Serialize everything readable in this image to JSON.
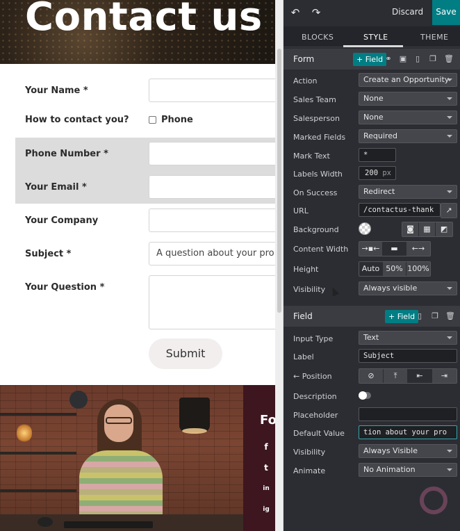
{
  "preview": {
    "hero_title": "Contact us",
    "form": {
      "fields": [
        {
          "label": "Your Name",
          "required": "*",
          "value": ""
        },
        {
          "label": "How to contact you?",
          "option": "Phone"
        },
        {
          "label": "Phone Number",
          "required": "*",
          "value": ""
        },
        {
          "label": "Your Email",
          "required": "*",
          "value": ""
        },
        {
          "label": "Your Company",
          "required": "",
          "value": ""
        },
        {
          "label": "Subject",
          "required": "*",
          "value": "A question about your pro"
        },
        {
          "label": "Your Question",
          "required": "*",
          "value": ""
        }
      ],
      "submit_label": "Submit"
    },
    "footer": {
      "heading": "Fo",
      "social": [
        "f",
        "t",
        "in",
        "ig"
      ]
    }
  },
  "editor": {
    "toolbar": {
      "undo_icon": "undo-icon",
      "redo_icon": "redo-icon",
      "discard_label": "Discard",
      "save_label": "Save"
    },
    "tabs": [
      {
        "label": "BLOCKS"
      },
      {
        "label": "STYLE"
      },
      {
        "label": "THEME"
      }
    ],
    "active_tab": "STYLE",
    "form_section": {
      "title": "Form",
      "add_field_label": "+ Field",
      "options": {
        "action": {
          "label": "Action",
          "value": "Create an Opportunity"
        },
        "sales_team": {
          "label": "Sales Team",
          "value": "None"
        },
        "salesperson": {
          "label": "Salesperson",
          "value": "None"
        },
        "marked_fields": {
          "label": "Marked Fields",
          "value": "Required"
        },
        "mark_text": {
          "label": "Mark Text",
          "value": "*"
        },
        "labels_width": {
          "label": "Labels Width",
          "value": "200",
          "unit": "px"
        },
        "on_success": {
          "label": "On Success",
          "value": "Redirect"
        },
        "url": {
          "label": "URL",
          "value": "/contactus-thank"
        },
        "background": {
          "label": "Background"
        },
        "content_width": {
          "label": "Content Width"
        },
        "height": {
          "label": "Height",
          "options": [
            "Auto",
            "50%",
            "100%"
          ]
        },
        "visibility": {
          "label": "Visibility",
          "value": "Always visible"
        }
      }
    },
    "field_section": {
      "title": "Field",
      "add_field_label": "+ Field",
      "options": {
        "input_type": {
          "label": "Input Type",
          "value": "Text"
        },
        "label": {
          "label": "Label",
          "value": "Subject"
        },
        "position": {
          "label": "← Position"
        },
        "description": {
          "label": "Description"
        },
        "placeholder": {
          "label": "Placeholder",
          "value": ""
        },
        "default_value": {
          "label": "Default Value",
          "value": "tion about your pro"
        },
        "visibility": {
          "label": "Visibility",
          "value": "Always Visible"
        },
        "animate": {
          "label": "Animate",
          "value": "No Animation"
        }
      }
    },
    "colors": {
      "accent": "#017e84",
      "panel": "#2b2d33"
    }
  }
}
